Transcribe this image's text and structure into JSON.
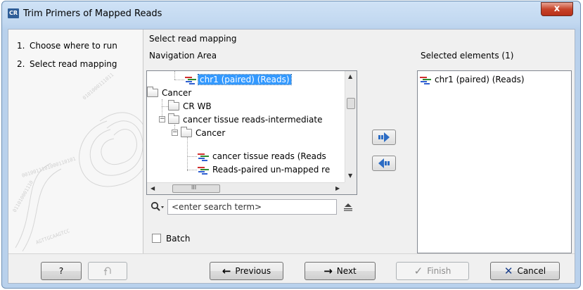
{
  "window": {
    "app_badge": "CR",
    "title": "Trim Primers of Mapped Reads",
    "close_label": "x"
  },
  "steps": [
    {
      "num": "1.",
      "label": "Choose where to run"
    },
    {
      "num": "2.",
      "label": "Select read mapping"
    }
  ],
  "main": {
    "heading": "Select read mapping",
    "nav_label": "Navigation Area",
    "selected_label": "Selected elements (1)",
    "tree": [
      {
        "label": "chr1 (paired) (Reads)",
        "icon": "reads-icon",
        "selected": true
      },
      {
        "label": "Cancer",
        "icon": "folder-icon"
      },
      {
        "label": "CR WB",
        "icon": "folder-icon"
      },
      {
        "label": "cancer tissue reads-intermediate",
        "icon": "folder-icon",
        "expander": "−"
      },
      {
        "label": "Cancer",
        "icon": "folder-icon",
        "expander": "−"
      },
      {
        "label": "cancer tissue reads (Reads",
        "icon": "reads-icon"
      },
      {
        "label": "Reads-paired un-mapped re",
        "icon": "reads-icon"
      }
    ],
    "hscroll_grip": "III",
    "search_placeholder": "<enter search term>",
    "batch_label": "Batch",
    "selected_elements": [
      {
        "label": "chr1 (paired) (Reads)",
        "icon": "reads-icon"
      }
    ]
  },
  "buttons": {
    "help": "?",
    "previous": "Previous",
    "next": "Next",
    "finish": "Finish",
    "cancel": "Cancel"
  },
  "colors": {
    "selection": "#3399ff",
    "arrow_blue": "#2c6cc4",
    "cancel_x": "#1a3f8a"
  }
}
